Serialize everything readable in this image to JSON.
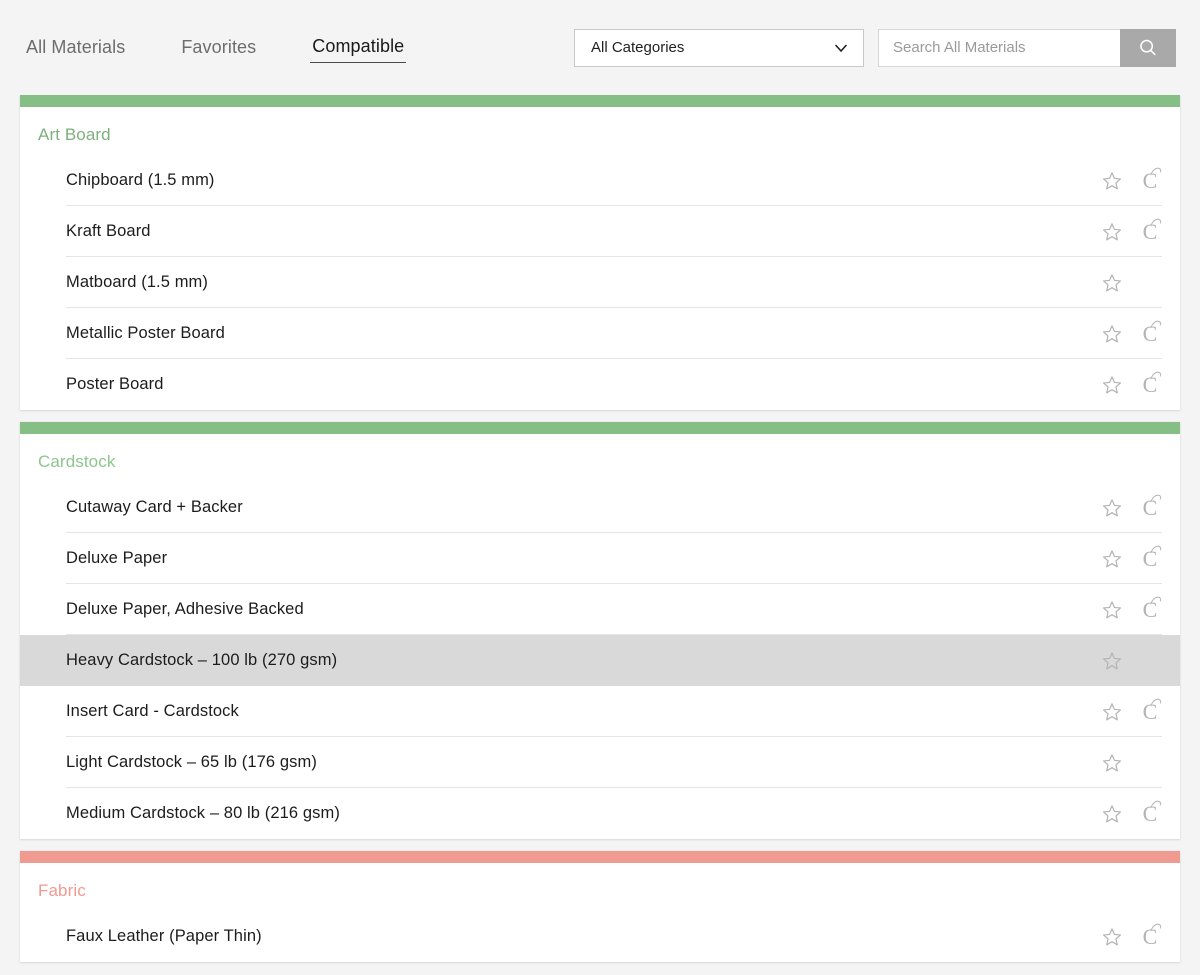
{
  "header": {
    "tabs": [
      {
        "label": "All Materials",
        "active": false
      },
      {
        "label": "Favorites",
        "active": false
      },
      {
        "label": "Compatible",
        "active": true
      }
    ],
    "category_filter": {
      "selected": "All Categories",
      "icon": "chevron-down-icon"
    },
    "search": {
      "value": "",
      "placeholder": "Search All Materials",
      "button_icon": "search-icon",
      "button_color": "#a9a9a9"
    }
  },
  "colors": {
    "page_background": "#f4f4f4",
    "card_background": "#ffffff",
    "selected_row": "#d9d9d9",
    "divider": "#e6e6e6",
    "green_accent": "#86bf86",
    "salmon_accent": "#ef9b92",
    "icon_gray": "#b4b4b4",
    "text_primary": "#1c1c1c",
    "text_muted": "#6d6d6d"
  },
  "sections": [
    {
      "name": "Art Board",
      "bar_color": "#86bf86",
      "title_color": "#7db07d",
      "items": [
        {
          "label": "Chipboard (1.5 mm)",
          "favorite_icon": "star-outline-icon",
          "cricut_icon": "cricut-c-icon",
          "has_cricut": true,
          "selected": false
        },
        {
          "label": "Kraft Board",
          "favorite_icon": "star-outline-icon",
          "cricut_icon": "cricut-c-icon",
          "has_cricut": true,
          "selected": false
        },
        {
          "label": "Matboard (1.5 mm)",
          "favorite_icon": "star-outline-icon",
          "cricut_icon": "",
          "has_cricut": false,
          "selected": false
        },
        {
          "label": "Metallic Poster Board",
          "favorite_icon": "star-outline-icon",
          "cricut_icon": "cricut-c-icon",
          "has_cricut": true,
          "selected": false
        },
        {
          "label": "Poster Board",
          "favorite_icon": "star-outline-icon",
          "cricut_icon": "cricut-c-icon",
          "has_cricut": true,
          "selected": false
        }
      ]
    },
    {
      "name": "Cardstock",
      "bar_color": "#86bf86",
      "title_color": "#8ec58e",
      "items": [
        {
          "label": "Cutaway Card + Backer",
          "favorite_icon": "star-outline-icon",
          "cricut_icon": "cricut-c-icon",
          "has_cricut": true,
          "selected": false
        },
        {
          "label": "Deluxe Paper",
          "favorite_icon": "star-outline-icon",
          "cricut_icon": "cricut-c-icon",
          "has_cricut": true,
          "selected": false
        },
        {
          "label": "Deluxe Paper, Adhesive Backed",
          "favorite_icon": "star-outline-icon",
          "cricut_icon": "cricut-c-icon",
          "has_cricut": true,
          "selected": false
        },
        {
          "label": "Heavy Cardstock – 100 lb (270 gsm)",
          "favorite_icon": "star-outline-icon",
          "cricut_icon": "",
          "has_cricut": false,
          "selected": true
        },
        {
          "label": "Insert Card - Cardstock",
          "favorite_icon": "star-outline-icon",
          "cricut_icon": "cricut-c-icon",
          "has_cricut": true,
          "selected": false
        },
        {
          "label": "Light Cardstock – 65 lb (176 gsm)",
          "favorite_icon": "star-outline-icon",
          "cricut_icon": "",
          "has_cricut": false,
          "selected": false
        },
        {
          "label": "Medium Cardstock – 80 lb (216 gsm)",
          "favorite_icon": "star-outline-icon",
          "cricut_icon": "cricut-c-icon",
          "has_cricut": true,
          "selected": false
        }
      ]
    },
    {
      "name": "Fabric",
      "bar_color": "#ef9b92",
      "title_color": "#ef9b92",
      "items": [
        {
          "label": "Faux Leather (Paper Thin)",
          "favorite_icon": "star-outline-icon",
          "cricut_icon": "cricut-c-icon",
          "has_cricut": true,
          "selected": false
        }
      ]
    }
  ]
}
